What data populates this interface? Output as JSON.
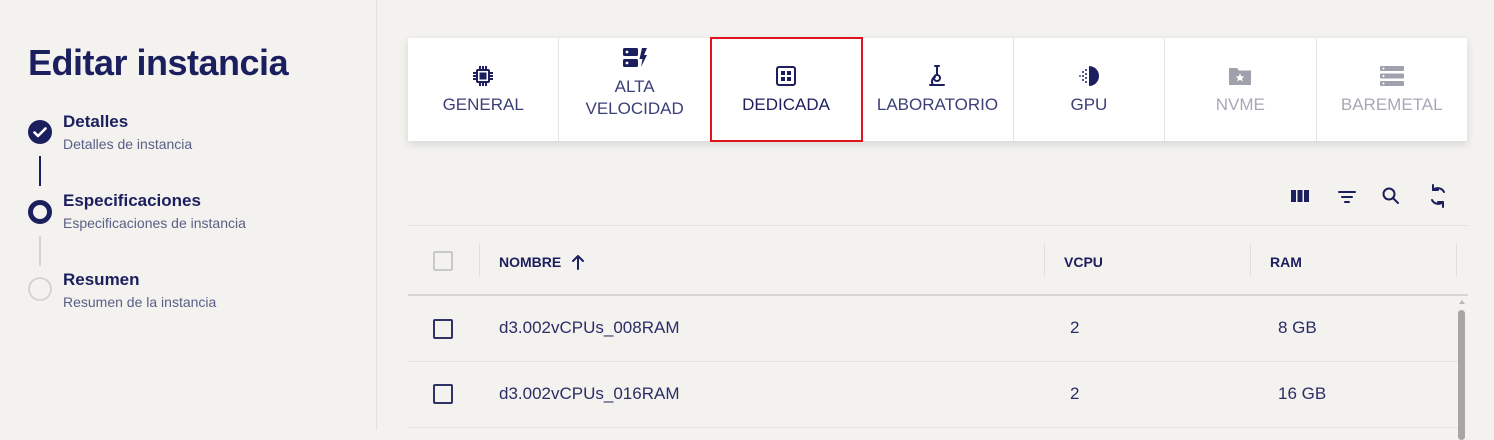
{
  "page": {
    "title": "Editar instancia"
  },
  "steps": [
    {
      "title": "Detalles",
      "subtitle": "Detalles de instancia",
      "status": "done"
    },
    {
      "title": "Especificaciones",
      "subtitle": "Especificaciones de instancia",
      "status": "active"
    },
    {
      "title": "Resumen",
      "subtitle": "Resumen de la instancia",
      "status": "pending"
    }
  ],
  "tabs": [
    {
      "label": "GENERAL",
      "icon": "cpu-chip-icon",
      "state": "normal"
    },
    {
      "label": "ALTA\nVELOCIDAD",
      "icon": "server-bolt-icon",
      "state": "normal"
    },
    {
      "label": "DEDICADA",
      "icon": "dedicated-chip-icon",
      "state": "selected"
    },
    {
      "label": "LABORATORIO",
      "icon": "microscope-icon",
      "state": "normal"
    },
    {
      "label": "GPU",
      "icon": "gpu-icon",
      "state": "normal"
    },
    {
      "label": "NVME",
      "icon": "folder-star-icon",
      "state": "disabled"
    },
    {
      "label": "BAREMETAL",
      "icon": "server-stack-icon",
      "state": "disabled"
    }
  ],
  "toolbar": {
    "icons": [
      "columns-icon",
      "filter-icon",
      "search-icon",
      "refresh-icon"
    ]
  },
  "table": {
    "columns": [
      "NOMBRE",
      "VCPU",
      "RAM"
    ],
    "sort": {
      "column": "NOMBRE",
      "direction": "ascending"
    },
    "rows": [
      {
        "name": "d3.002vCPUs_008RAM",
        "vcpu": "2",
        "ram": "8 GB"
      },
      {
        "name": "d3.002vCPUs_016RAM",
        "vcpu": "2",
        "ram": "16 GB"
      }
    ]
  },
  "colors": {
    "primary": "#1b1f5e",
    "selected_outline": "#e0141e",
    "background": "#f3f2ef"
  }
}
